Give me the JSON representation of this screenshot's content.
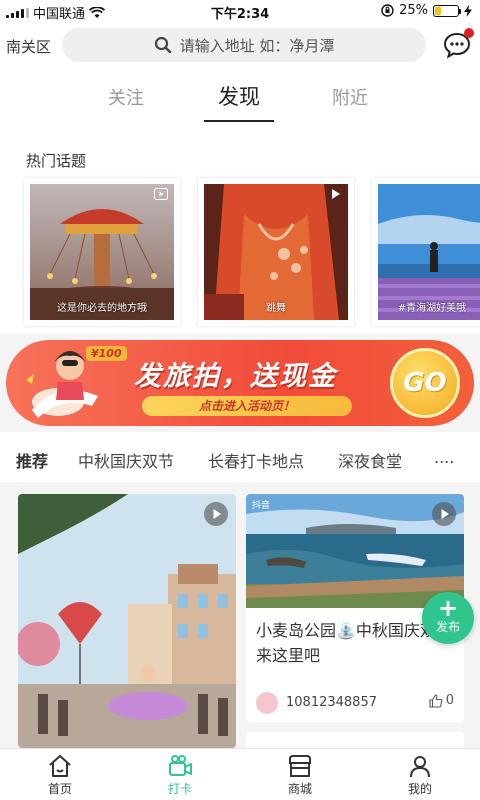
{
  "status_bar": {
    "carrier": "中国联通",
    "time": "下午2:34",
    "battery": "25%",
    "battery_level": 0.25
  },
  "header": {
    "city": "南关区",
    "search_placeholder": "请输入地址  如：净月潭"
  },
  "tabs": [
    {
      "label": "关注",
      "active": false
    },
    {
      "label": "发现",
      "active": true
    },
    {
      "label": "附近",
      "active": false
    }
  ],
  "hot_topics": {
    "title": "热门话题",
    "items": [
      {
        "caption": "这是你必去的地方哦"
      },
      {
        "caption": "跳舞"
      },
      {
        "caption": "#青海湖好美哦"
      }
    ]
  },
  "banner": {
    "badge": "¥100",
    "title": "发旅拍，送现金",
    "subtitle": "点击进入活动页！",
    "go": "GO"
  },
  "categories": [
    {
      "label": "推荐",
      "active": true
    },
    {
      "label": "中秋国庆双节",
      "active": false
    },
    {
      "label": "长春打卡地点",
      "active": false
    },
    {
      "label": "深夜食堂",
      "active": false
    },
    {
      "label": "....",
      "active": false
    }
  ],
  "feed": {
    "card2": {
      "source_tag": "抖音",
      "title": "小麦岛公园⛲中秋国庆双节来这里吧",
      "user": "10812348857",
      "likes": "0"
    }
  },
  "publish": {
    "plus": "+",
    "label": "发布"
  },
  "bottom_nav": [
    {
      "label": "首页",
      "icon": "home-icon",
      "active": false
    },
    {
      "label": "打卡",
      "icon": "video-camera-icon",
      "active": true
    },
    {
      "label": "商城",
      "icon": "store-icon",
      "active": false
    },
    {
      "label": "我的",
      "icon": "person-icon",
      "active": false
    }
  ],
  "colors": {
    "accent": "#2fc58d",
    "banner": "#f24b3a",
    "badge_red": "#e02020"
  }
}
